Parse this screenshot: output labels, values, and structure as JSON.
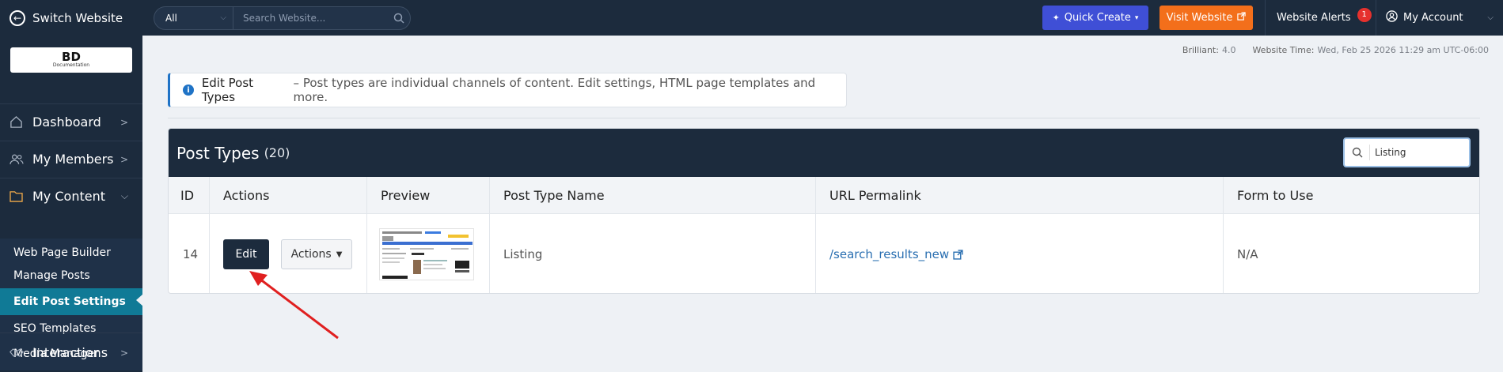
{
  "topbar": {
    "switch_label": "Switch Website",
    "search_scope": "All",
    "search_placeholder": "Search Website...",
    "quick_create": "Quick Create",
    "visit_website": "Visit Website",
    "alerts_label": "Website Alerts",
    "alerts_count": "1",
    "account_label": "My Account"
  },
  "sidebar": {
    "logo_text": "BD",
    "logo_sub": "Documentation",
    "items": [
      {
        "label": "Dashboard"
      },
      {
        "label": "My Members"
      },
      {
        "label": "My Content"
      },
      {
        "label": "Interactions"
      }
    ],
    "submenu": [
      {
        "label": "Web Page Builder"
      },
      {
        "label": "Manage Posts"
      },
      {
        "label": "Edit Post Settings"
      },
      {
        "label": "SEO Templates"
      },
      {
        "label": "Media Manager"
      }
    ]
  },
  "meta": {
    "version_label": "Brilliant:",
    "version": "4.0",
    "time_label": "Website Time:",
    "time": "Wed, Feb 25 2026 11:29 am UTC-06:00"
  },
  "info": {
    "title": "Edit Post Types",
    "description": "– Post types are individual channels of content. Edit settings, HTML page templates and more."
  },
  "panel": {
    "title": "Post Types",
    "count": "(20)",
    "search_value": "Listing",
    "columns": [
      "ID",
      "Actions",
      "Preview",
      "Post Type Name",
      "URL Permalink",
      "Form to Use"
    ],
    "rows": [
      {
        "id": "14",
        "edit": "Edit",
        "actions": "Actions",
        "name": "Listing",
        "permalink": "/search_results_new",
        "form": "N/A"
      }
    ]
  },
  "colors": {
    "navy": "#1c2b3d",
    "accent_blue": "#3f4fd6",
    "accent_orange": "#f36f1b",
    "active_teal": "#107a96",
    "arrow_red": "#e02020"
  }
}
